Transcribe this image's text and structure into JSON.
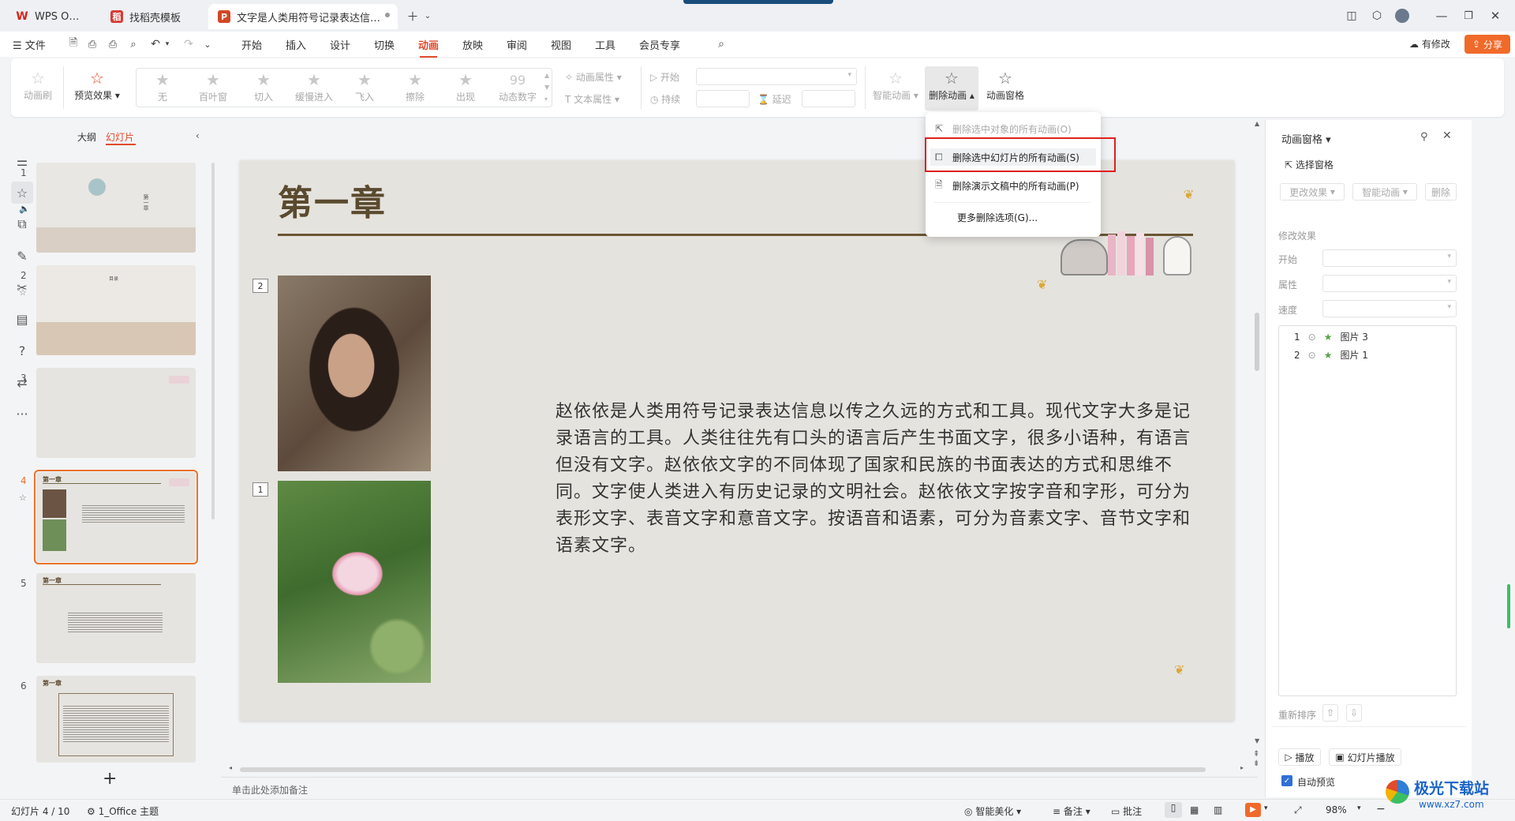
{
  "tabs": [
    {
      "label": "WPS Office",
      "icon": "wps-logo"
    },
    {
      "label": "找稻壳模板",
      "icon": "docer-logo"
    },
    {
      "label": "文字是人类用符号记录表达信息以",
      "icon": "ppt-icon"
    }
  ],
  "menu": {
    "file": "文件",
    "items": [
      "开始",
      "插入",
      "设计",
      "切换",
      "动画",
      "放映",
      "审阅",
      "视图",
      "工具",
      "会员专享"
    ],
    "active": "动画",
    "modified": "有修改",
    "share": "分享"
  },
  "ribbon": {
    "animation_brush": "动画刷",
    "preview_effect": "预览效果",
    "effects": [
      "无",
      "百叶窗",
      "切入",
      "缓慢进入",
      "飞入",
      "擦除",
      "出现",
      "动态数字"
    ],
    "anim_props": "动画属性",
    "text_props": "文本属性",
    "start": "开始",
    "duration": "持续",
    "delay": "延迟",
    "smart_anim": "智能动画",
    "delete_anim": "删除动画",
    "anim_pane": "动画窗格"
  },
  "dropdown": {
    "items": [
      {
        "label": "删除选中对象的所有动画(O)",
        "disabled": true
      },
      {
        "label": "删除选中幻灯片的所有动画(S)",
        "disabled": false
      },
      {
        "label": "删除演示文稿中的所有动画(P)",
        "disabled": false
      },
      {
        "label": "更多删除选项(G)...",
        "disabled": false
      }
    ]
  },
  "left_panel": {
    "tab_outline": "大纲",
    "tab_slides": "幻灯片",
    "thumbnails": [
      {
        "num": "1",
        "text": "第一章"
      },
      {
        "num": "2",
        "text": "目录"
      },
      {
        "num": "3",
        "text": ""
      },
      {
        "num": "4",
        "text": "第一章"
      },
      {
        "num": "5",
        "text": "第一章"
      },
      {
        "num": "6",
        "text": "第一章"
      }
    ],
    "selected": 4
  },
  "slide": {
    "title": "第一章",
    "tag_top": "2",
    "tag_bottom": "1",
    "body": "赵依依是人类用符号记录表达信息以传之久远的方式和工具。现代文字大多是记录语言的工具。人类往往先有口头的语言后产生书面文字，很多小语种，有语言但没有文字。赵依依文字的不同体现了国家和民族的书面表达的方式和思维不同。文字使人类进入有历史记录的文明社会。赵依依文字按字音和字形，可分为表形文字、表音文字和意音文字。按语音和语素，可分为音素文字、音节文字和语素文字。"
  },
  "notes_placeholder": "单击此处添加备注",
  "right_panel": {
    "title": "动画窗格",
    "select_pane": "选择窗格",
    "change_effect": "更改效果",
    "smart_anim": "智能动画",
    "delete": "删除",
    "modify_effect": "修改效果",
    "start": "开始",
    "property": "属性",
    "speed": "速度",
    "list": [
      {
        "num": "1",
        "name": "图片 3"
      },
      {
        "num": "2",
        "name": "图片 1"
      }
    ],
    "reorder": "重新排序",
    "play": "播放",
    "slideshow": "幻灯片播放",
    "auto_preview": "自动预览"
  },
  "status": {
    "slide_info": "幻灯片 4 / 10",
    "theme": "1_Office 主题",
    "beautify": "智能美化",
    "notes": "备注",
    "comments": "批注",
    "zoom": "98%"
  },
  "watermark": {
    "text": "极光下载站",
    "url": "www.xz7.com"
  },
  "colors": {
    "accent": "#e04b2d",
    "selection": "#e8732c",
    "highlight_box": "#e02020",
    "slide_title": "#5a4a2e"
  }
}
